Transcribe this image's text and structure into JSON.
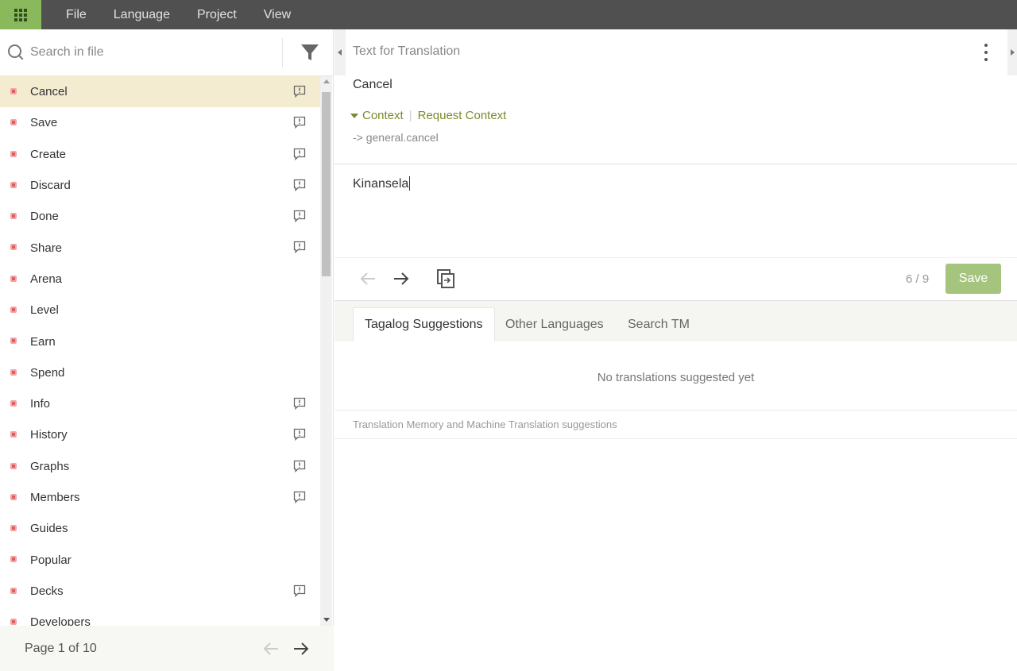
{
  "topbar": {
    "menu": [
      "File",
      "Language",
      "Project",
      "View"
    ]
  },
  "sidebar": {
    "search_placeholder": "Search in file",
    "items": [
      {
        "label": "Cancel",
        "comment": true
      },
      {
        "label": "Save",
        "comment": true
      },
      {
        "label": "Create",
        "comment": true
      },
      {
        "label": "Discard",
        "comment": true
      },
      {
        "label": "Done",
        "comment": true
      },
      {
        "label": "Share",
        "comment": true
      },
      {
        "label": "Arena",
        "comment": false
      },
      {
        "label": "Level",
        "comment": false
      },
      {
        "label": "Earn",
        "comment": false
      },
      {
        "label": "Spend",
        "comment": false
      },
      {
        "label": "Info",
        "comment": true
      },
      {
        "label": "History",
        "comment": true
      },
      {
        "label": "Graphs",
        "comment": true
      },
      {
        "label": "Members",
        "comment": true
      },
      {
        "label": "Guides",
        "comment": false
      },
      {
        "label": "Popular",
        "comment": false
      },
      {
        "label": "Decks",
        "comment": true
      },
      {
        "label": "Developers",
        "comment": false
      }
    ],
    "page_label": "Page 1 of 10"
  },
  "editor": {
    "section_title": "Text for Translation",
    "source_text": "Cancel",
    "context_label": "Context",
    "request_context_label": "Request Context",
    "context_key": "-> general.cancel",
    "translation_value": "Kinansela",
    "counter": "6 / 9",
    "save_label": "Save"
  },
  "suggestions": {
    "tabs": [
      "Tagalog Suggestions",
      "Other Languages",
      "Search TM"
    ],
    "empty_message": "No translations suggested yet",
    "footnote": "Translation Memory and Machine Translation suggestions"
  },
  "colors": {
    "topbar": "#505050",
    "apps_button": "#8ab85c",
    "selected_row": "#f4ecd1",
    "accent": "#7a8b2a",
    "save_button": "#a5c57e",
    "status_untranslated": "#e35a5a"
  }
}
